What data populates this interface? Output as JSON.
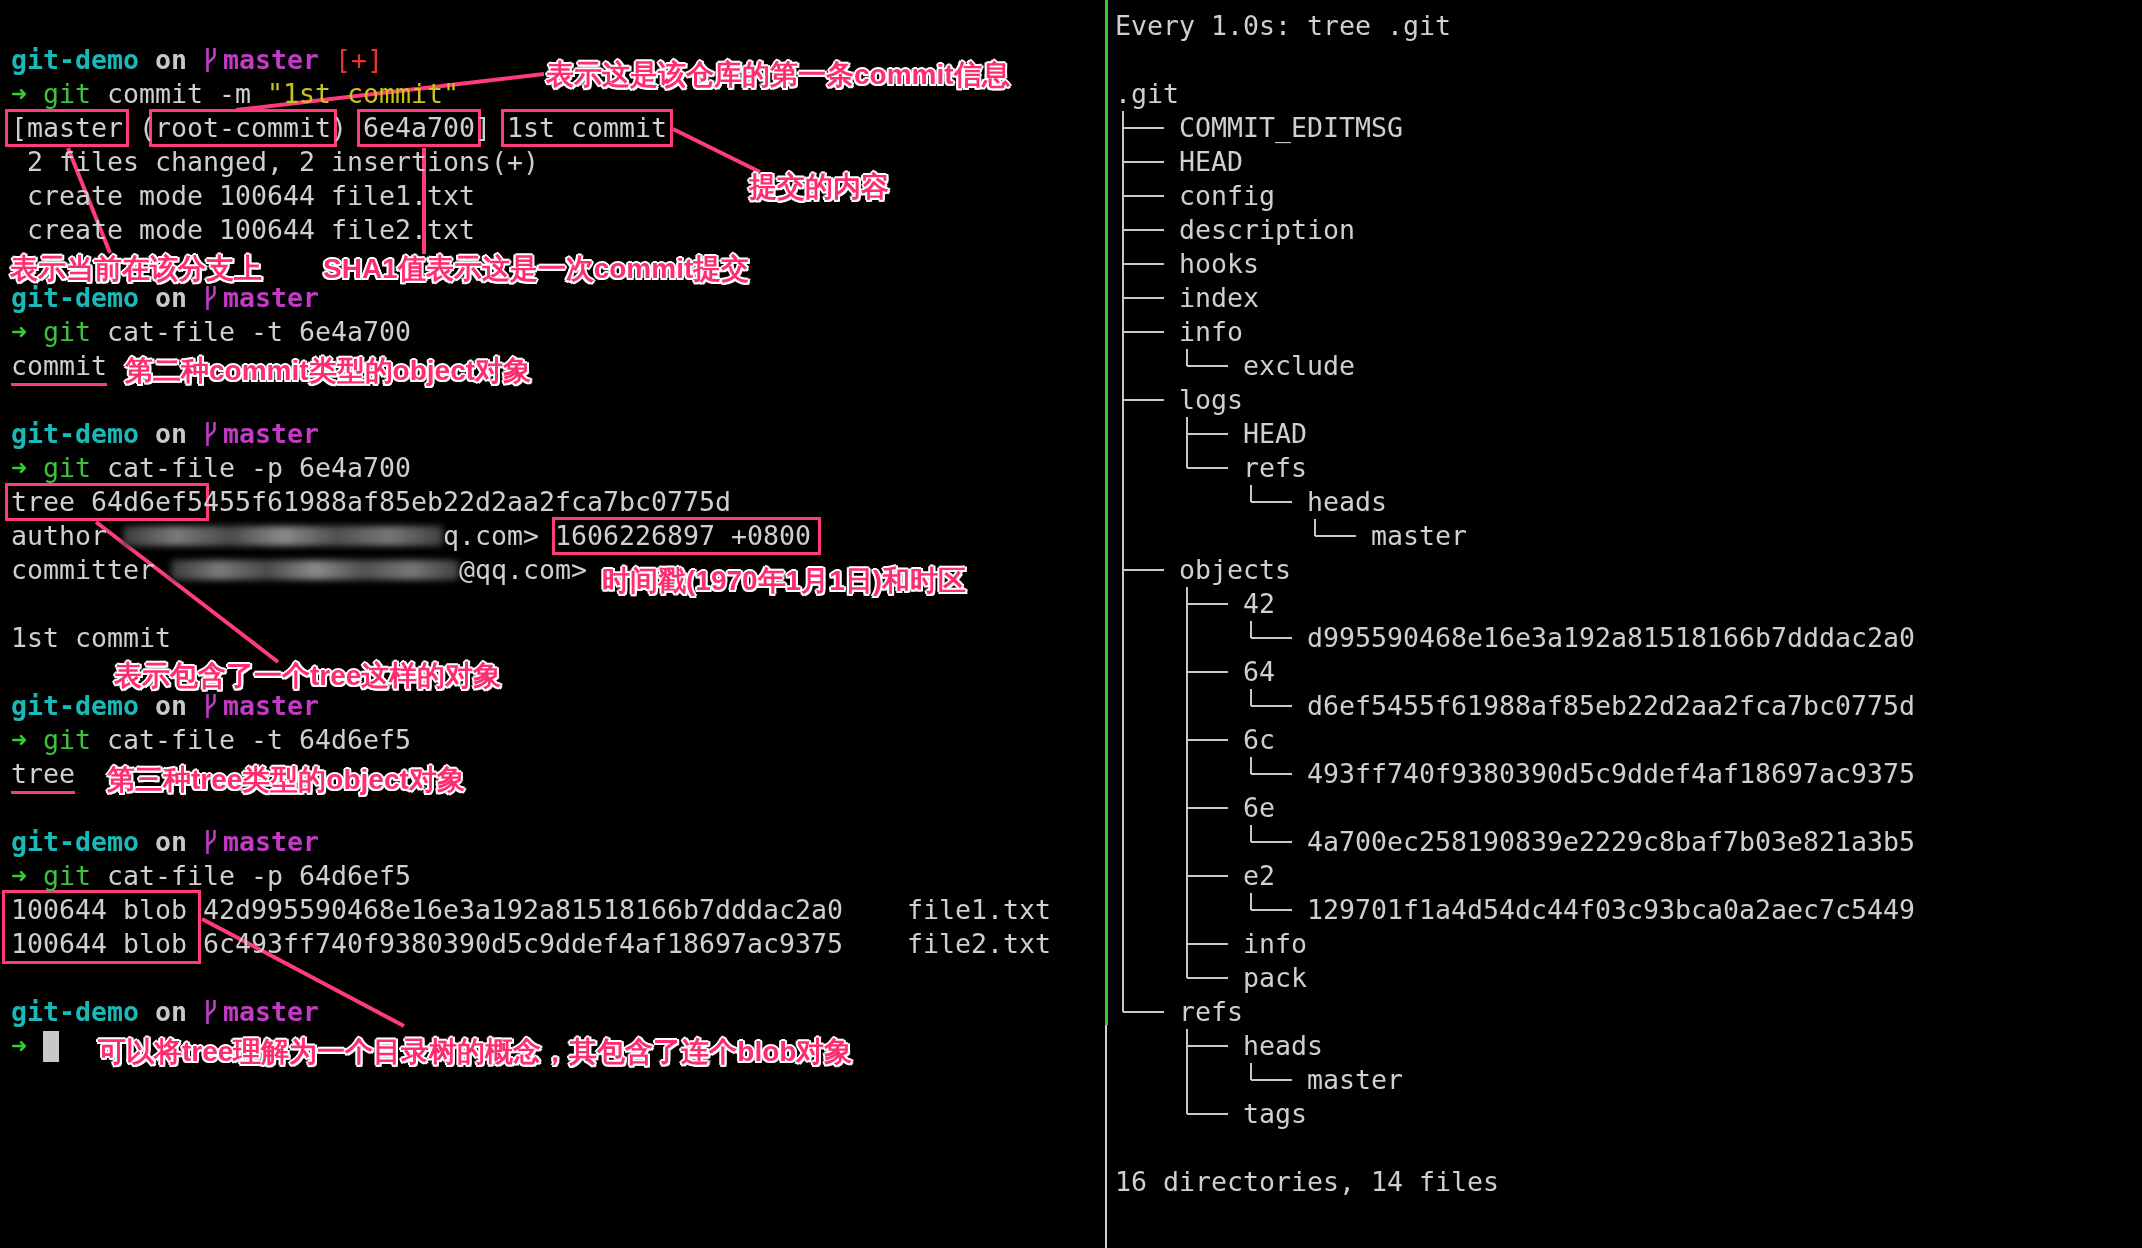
{
  "terminal": {
    "lines": [
      {
        "kind": "blank"
      },
      {
        "kind": "prompt",
        "dir": "git-demo",
        "word": "on",
        "branch": "master",
        "status": "[+]"
      },
      {
        "kind": "command",
        "arrow": "➜",
        "program": "git",
        "args": "commit -m",
        "quoted": "\"1st commit\""
      },
      {
        "kind": "output",
        "segments": [
          {
            "text": "[master",
            "boxed": true
          },
          {
            "text": " (",
            "boxed": false
          },
          {
            "text": "root-commit",
            "boxed": true
          },
          {
            "text": ") ",
            "boxed": false
          },
          {
            "text": "6e4a700",
            "boxed": true
          },
          {
            "text": "] ",
            "boxed": false
          },
          {
            "text": "1st commit",
            "boxed": true
          }
        ]
      },
      {
        "kind": "output",
        "segments": [
          {
            "text": " 2 files changed, 2 insertions(+)"
          }
        ]
      },
      {
        "kind": "output",
        "segments": [
          {
            "text": " create mode 100644 file1.txt"
          }
        ]
      },
      {
        "kind": "output",
        "segments": [
          {
            "text": " create mode 100644 file2.txt"
          }
        ]
      },
      {
        "kind": "blank"
      },
      {
        "kind": "prompt",
        "dir": "git-demo",
        "word": "on",
        "branch": "master"
      },
      {
        "kind": "command",
        "arrow": "➜",
        "program": "git",
        "args": "cat-file -t 6e4a700"
      },
      {
        "kind": "output",
        "segments": [
          {
            "text": "commit",
            "underlined": true
          }
        ]
      },
      {
        "kind": "blank"
      },
      {
        "kind": "prompt",
        "dir": "git-demo",
        "word": "on",
        "branch": "master"
      },
      {
        "kind": "command",
        "arrow": "➜",
        "program": "git",
        "args": "cat-file -p 6e4a700"
      },
      {
        "kind": "output",
        "segments": [
          {
            "text": "tree 64d6ef5",
            "boxed": true
          },
          {
            "text": "455f61988af85eb22d2aa2fca7bc0775d",
            "boxed": false
          }
        ]
      },
      {
        "kind": "signature",
        "label": "author",
        "tail": "q.com>",
        "timestamp": "1606226897 +0800",
        "boxed": true
      },
      {
        "kind": "signature",
        "label": "committer",
        "tail": "@qq.com>"
      },
      {
        "kind": "blank"
      },
      {
        "kind": "output",
        "segments": [
          {
            "text": "1st commit"
          }
        ]
      },
      {
        "kind": "blank"
      },
      {
        "kind": "prompt",
        "dir": "git-demo",
        "word": "on",
        "branch": "master"
      },
      {
        "kind": "command",
        "arrow": "➜",
        "program": "git",
        "args": "cat-file -t 64d6ef5"
      },
      {
        "kind": "output",
        "segments": [
          {
            "text": "tree",
            "underlined": true
          }
        ]
      },
      {
        "kind": "blank"
      },
      {
        "kind": "prompt",
        "dir": "git-demo",
        "word": "on",
        "branch": "master"
      },
      {
        "kind": "command",
        "arrow": "➜",
        "program": "git",
        "args": "cat-file -p 64d6ef5"
      },
      {
        "kind": "listing",
        "boxed": true,
        "entries": [
          {
            "mode": "100644",
            "type": "blob",
            "hash": "42d995590468e16e3a192a81518166b7dddac2a0",
            "file": "file1.txt"
          },
          {
            "mode": "100644",
            "type": "blob",
            "hash": "6c493ff740f9380390d5c9ddef4af18697ac9375",
            "file": "file2.txt"
          }
        ]
      },
      {
        "kind": "blank"
      },
      {
        "kind": "prompt",
        "dir": "git-demo",
        "word": "on",
        "branch": "master"
      },
      {
        "kind": "cursor",
        "arrow": "➜"
      }
    ]
  },
  "annotations": [
    "表示这是该仓库的第一条commit信息",
    "提交的内容",
    "表示当前在该分支上",
    "SHA1值表示这是一次commit提交",
    "第二种commit类型的object对象",
    "时间戳(1970年1月1日)和时区",
    "表示包含了一个tree这样的对象",
    "第三种tree类型的object对象",
    "可以将tree理解为一个目录树的概念，其包含了连个blob对象"
  ],
  "watch_pane": {
    "header": "Every 1.0s: tree .git",
    "tree": {
      "name": ".git",
      "children": [
        {
          "name": "COMMIT_EDITMSG"
        },
        {
          "name": "HEAD"
        },
        {
          "name": "config"
        },
        {
          "name": "description"
        },
        {
          "name": "hooks"
        },
        {
          "name": "index"
        },
        {
          "name": "info",
          "children": [
            {
              "name": "exclude"
            }
          ]
        },
        {
          "name": "logs",
          "children": [
            {
              "name": "HEAD"
            },
            {
              "name": "refs",
              "children": [
                {
                  "name": "heads",
                  "children": [
                    {
                      "name": "master"
                    }
                  ]
                }
              ]
            }
          ]
        },
        {
          "name": "objects",
          "children": [
            {
              "name": "42",
              "children": [
                {
                  "name": "d995590468e16e3a192a81518166b7dddac2a0"
                }
              ]
            },
            {
              "name": "64",
              "children": [
                {
                  "name": "d6ef5455f61988af85eb22d2aa2fca7bc0775d"
                }
              ]
            },
            {
              "name": "6c",
              "children": [
                {
                  "name": "493ff740f9380390d5c9ddef4af18697ac9375"
                }
              ]
            },
            {
              "name": "6e",
              "children": [
                {
                  "name": "4a700ec258190839e2229c8baf7b03e821a3b5"
                }
              ]
            },
            {
              "name": "e2",
              "children": [
                {
                  "name": "129701f1a4d54dc44f03c93bca0a2aec7c5449"
                }
              ]
            },
            {
              "name": "info"
            },
            {
              "name": "pack"
            }
          ]
        },
        {
          "name": "refs",
          "children": [
            {
              "name": "heads",
              "children": [
                {
                  "name": "master"
                }
              ]
            },
            {
              "name": "tags"
            }
          ]
        }
      ]
    },
    "summary": "16 directories, 14 files"
  }
}
